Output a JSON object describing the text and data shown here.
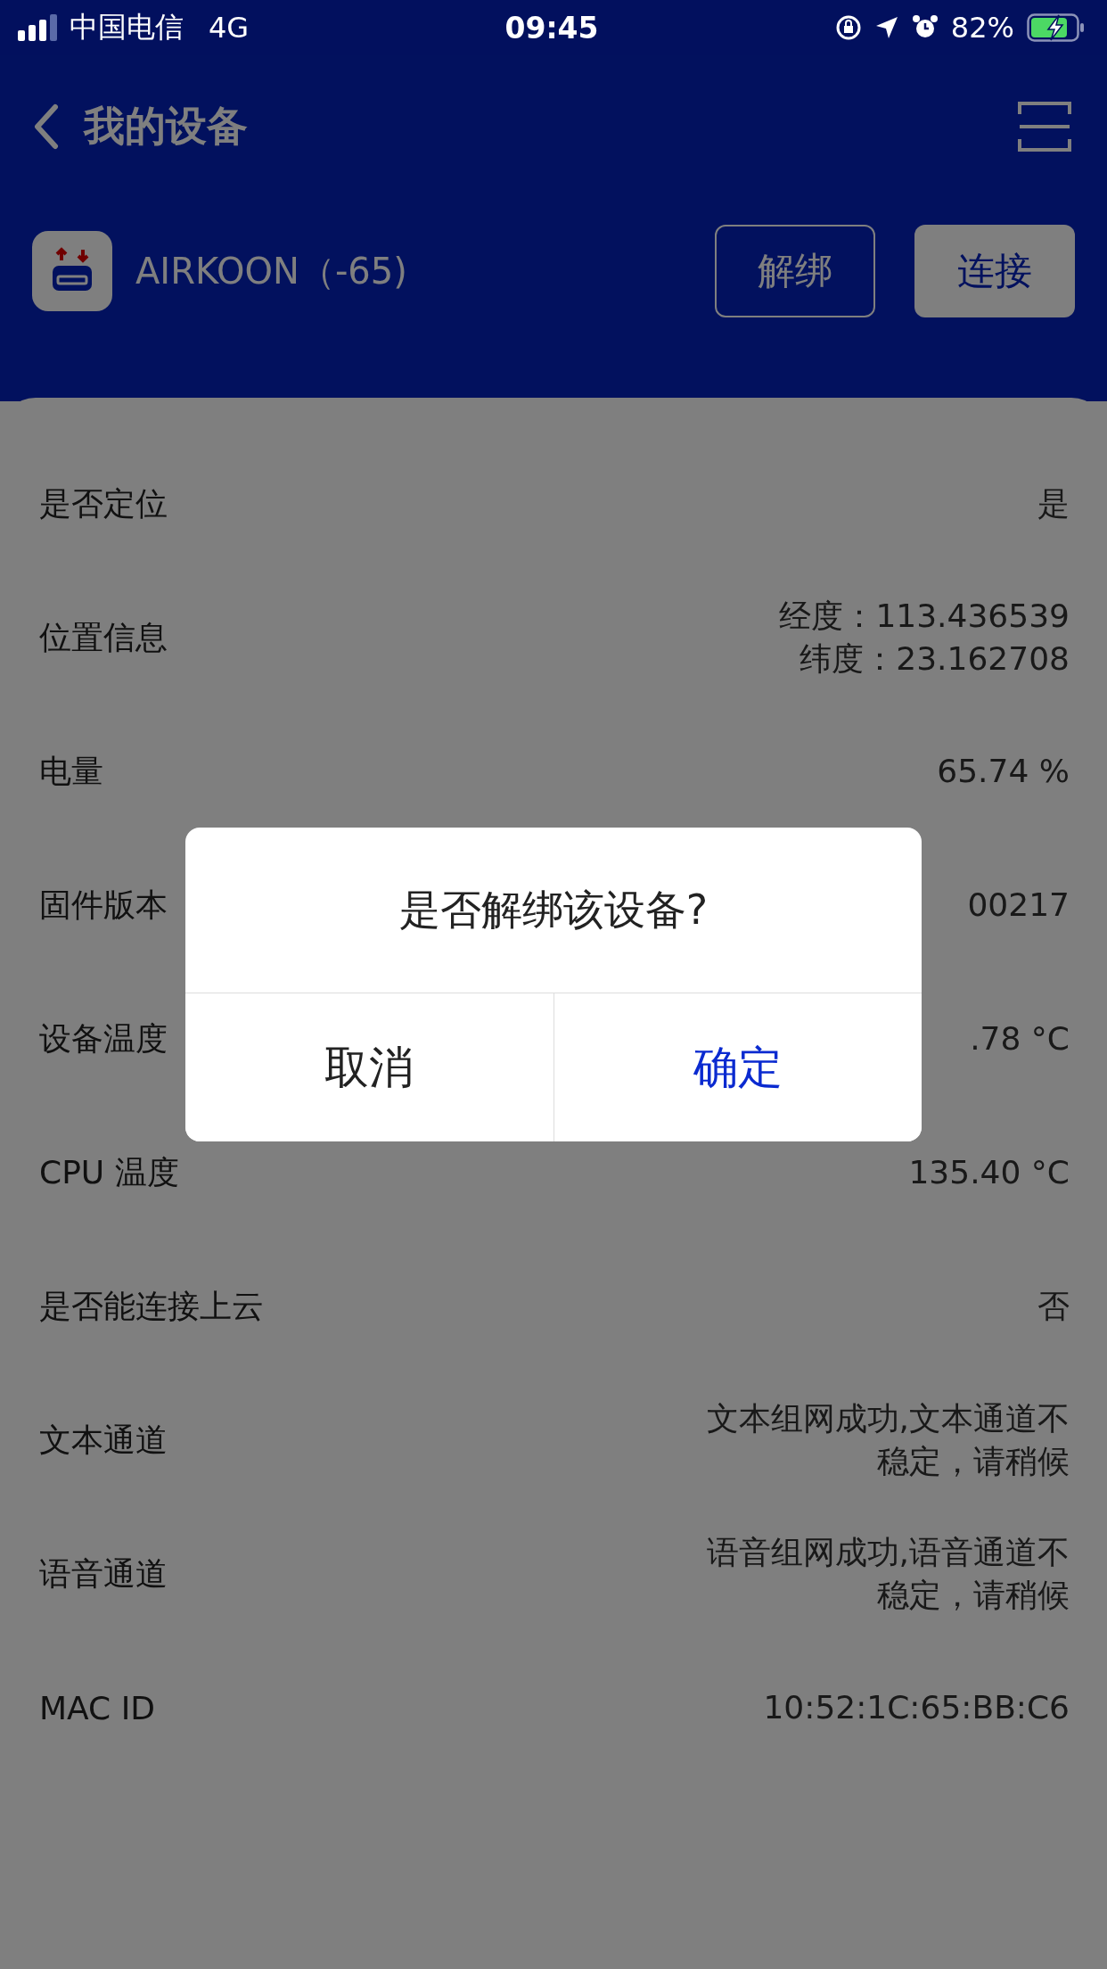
{
  "status_bar": {
    "carrier": "中国电信",
    "network": "4G",
    "time": "09:45",
    "battery": "82%"
  },
  "header": {
    "title": "我的设备"
  },
  "device": {
    "name": "AIRKOON（-65)",
    "unbind_button": "解绑",
    "connect_button": "连接"
  },
  "rows": [
    {
      "label": "是否定位",
      "value": [
        "是"
      ]
    },
    {
      "label": "位置信息",
      "value": [
        "经度：113.436539",
        "纬度：23.162708"
      ]
    },
    {
      "label": "电量",
      "value": [
        "65.74 %"
      ]
    },
    {
      "label": "固件版本",
      "value": [
        "00217"
      ]
    },
    {
      "label": "设备温度",
      "value": [
        ".78 °C"
      ]
    },
    {
      "label": "CPU 温度",
      "value": [
        "135.40 °C"
      ]
    },
    {
      "label": "是否能连接上云",
      "value": [
        "否"
      ]
    },
    {
      "label": "文本通道",
      "value": [
        "文本组网成功,文本通道不",
        "稳定，请稍候"
      ]
    },
    {
      "label": "语音通道",
      "value": [
        "语音组网成功,语音通道不",
        "稳定，请稍候"
      ]
    },
    {
      "label": "MAC ID",
      "value": [
        "10:52:1C:65:BB:C6"
      ]
    }
  ],
  "dialog": {
    "title": "是否解绑该设备?",
    "buttons": [
      {
        "label": "取消",
        "kind": "cancel"
      },
      {
        "label": "确定",
        "kind": "confirm"
      }
    ]
  }
}
